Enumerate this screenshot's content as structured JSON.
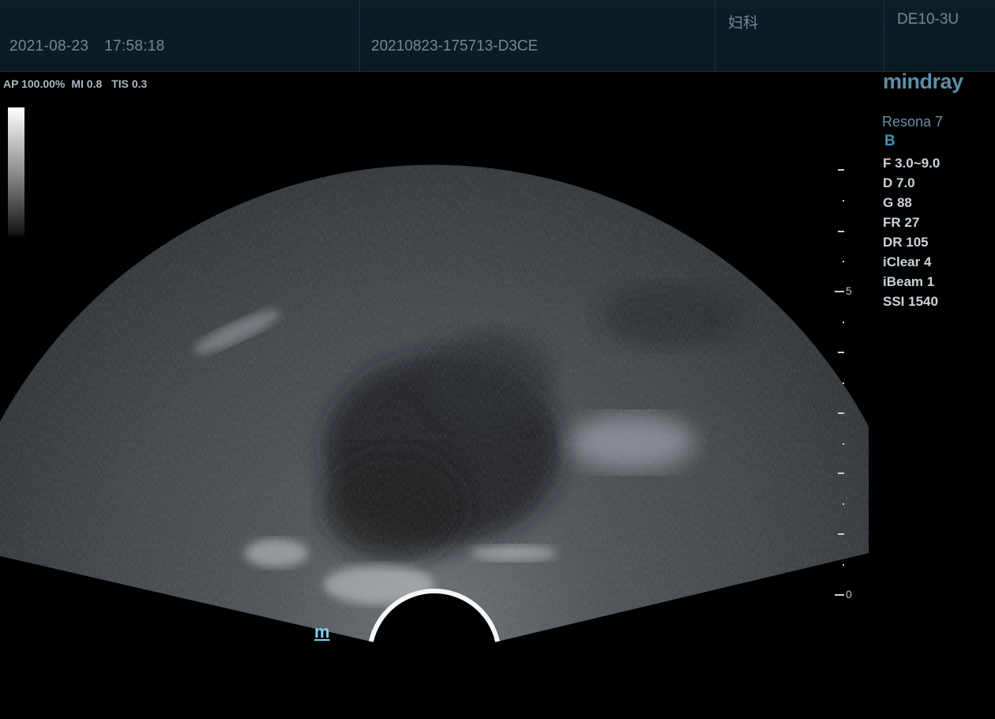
{
  "header": {
    "date": "2021-08-23",
    "time": "17:58:18",
    "patient_id": "20210823-175713-D3CE",
    "department": "妇科",
    "probe": "DE10-3U"
  },
  "acoustic": {
    "ap": "AP 100.00%",
    "mi": "MI 0.8",
    "tis": "TIS 0.3"
  },
  "system": {
    "brand": "mindray",
    "model": "Resona 7",
    "mode": "B"
  },
  "params": [
    "F 3.0~9.0",
    "D 7.0",
    "G 88",
    "FR 27",
    "DR 105",
    "iClear 4",
    "iBeam 1",
    "SSI 1540"
  ],
  "depth_scale": {
    "labels": [
      "5",
      "0"
    ]
  },
  "orientation_marker": "m",
  "colors": {
    "accent": "#4a90b8",
    "header_bg": "#0d1d27",
    "marker": "#7fd0ea"
  }
}
